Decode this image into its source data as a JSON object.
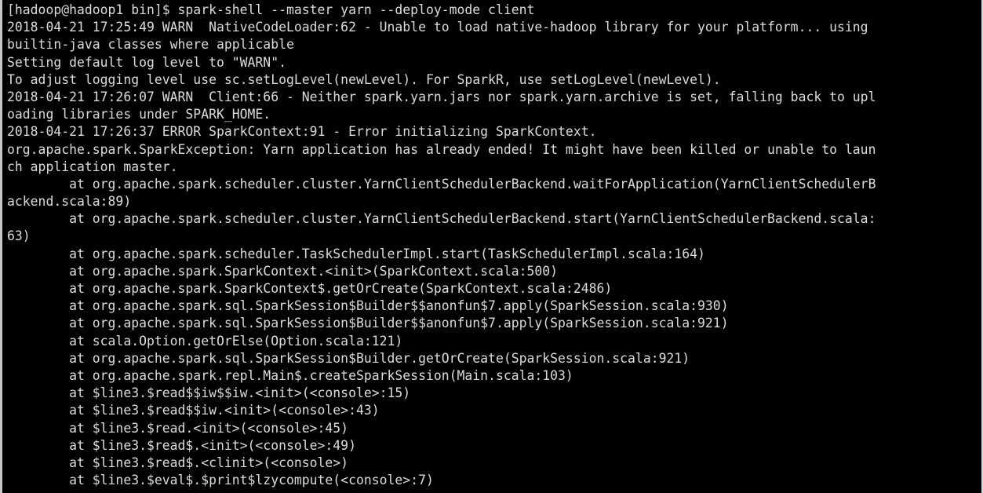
{
  "terminal": {
    "app": "terminal-emulator",
    "background_color": "#000000",
    "foreground_color": "#dcdcdc",
    "border_color": "#c8c8cc",
    "columns": 124,
    "rows": 28,
    "prompt": "[hadoop@hadoop1 bin]$",
    "command": "spark-shell --master yarn --deploy-mode client",
    "lines": [
      "[hadoop@hadoop1 bin]$ spark-shell --master yarn --deploy-mode client",
      "2018-04-21 17:25:49 WARN  NativeCodeLoader:62 - Unable to load native-hadoop library for your platform... using",
      "builtin-java classes where applicable",
      "Setting default log level to \"WARN\".",
      "To adjust logging level use sc.setLogLevel(newLevel). For SparkR, use setLogLevel(newLevel).",
      "2018-04-21 17:26:07 WARN  Client:66 - Neither spark.yarn.jars nor spark.yarn.archive is set, falling back to upl",
      "oading libraries under SPARK_HOME.",
      "2018-04-21 17:26:37 ERROR SparkContext:91 - Error initializing SparkContext.",
      "org.apache.spark.SparkException: Yarn application has already ended! It might have been killed or unable to laun",
      "ch application master.",
      "        at org.apache.spark.scheduler.cluster.YarnClientSchedulerBackend.waitForApplication(YarnClientSchedulerB",
      "ackend.scala:89)",
      "        at org.apache.spark.scheduler.cluster.YarnClientSchedulerBackend.start(YarnClientSchedulerBackend.scala:",
      "63)",
      "        at org.apache.spark.scheduler.TaskSchedulerImpl.start(TaskSchedulerImpl.scala:164)",
      "        at org.apache.spark.SparkContext.<init>(SparkContext.scala:500)",
      "        at org.apache.spark.SparkContext$.getOrCreate(SparkContext.scala:2486)",
      "        at org.apache.spark.sql.SparkSession$Builder$$anonfun$7.apply(SparkSession.scala:930)",
      "        at org.apache.spark.sql.SparkSession$Builder$$anonfun$7.apply(SparkSession.scala:921)",
      "        at scala.Option.getOrElse(Option.scala:121)",
      "        at org.apache.spark.sql.SparkSession$Builder.getOrCreate(SparkSession.scala:921)",
      "        at org.apache.spark.repl.Main$.createSparkSession(Main.scala:103)",
      "        at $line3.$read$$iw$$iw.<init>(<console>:15)",
      "        at $line3.$read$$iw.<init>(<console>:43)",
      "        at $line3.$read.<init>(<console>:45)",
      "        at $line3.$read$.<init>(<console>:49)",
      "        at $line3.$read$.<clinit>(<console>)",
      "        at $line3.$eval$.$print$lzycompute(<console>:7)"
    ]
  }
}
